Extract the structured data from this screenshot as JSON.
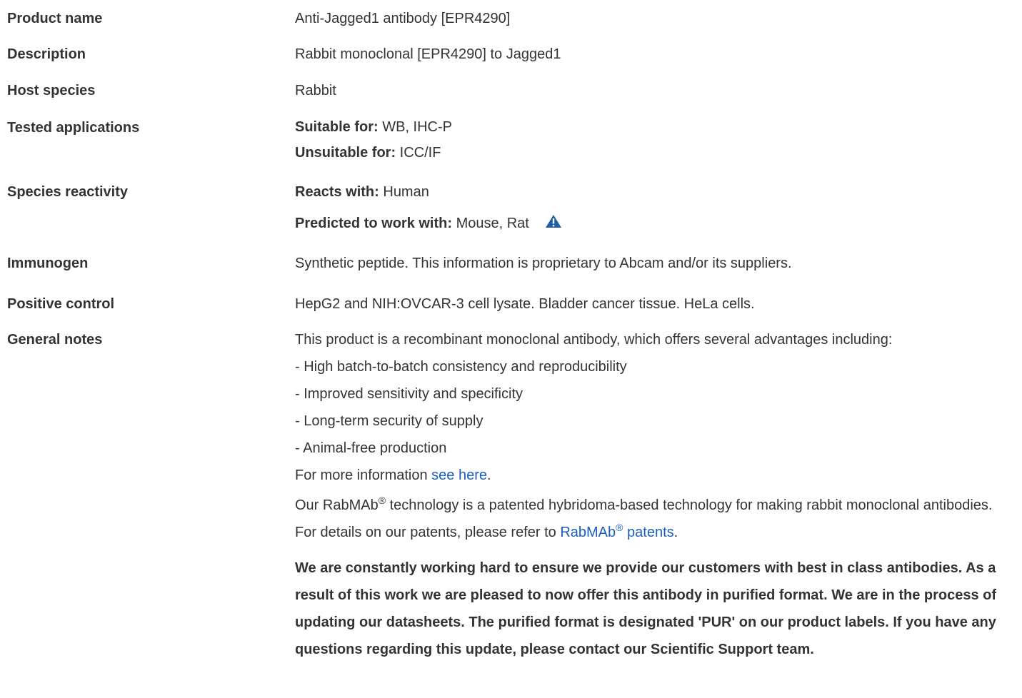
{
  "rows": {
    "product_name": {
      "label": "Product name",
      "value": "Anti-Jagged1 antibody [EPR4290]"
    },
    "description": {
      "label": "Description",
      "value": "Rabbit monoclonal [EPR4290] to Jagged1"
    },
    "host_species": {
      "label": "Host species",
      "value": "Rabbit"
    },
    "tested_applications": {
      "label": "Tested applications",
      "suitable_label": "Suitable for:",
      "suitable_value": " WB, IHC-P",
      "unsuitable_label": "Unsuitable for:",
      "unsuitable_value": " ICC/IF"
    },
    "species_reactivity": {
      "label": "Species reactivity",
      "reacts_label": "Reacts with:",
      "reacts_value": " Human",
      "predicted_label": "Predicted to work with:",
      "predicted_value": " Mouse, Rat",
      "icon": "warning-triangle-icon"
    },
    "immunogen": {
      "label": "Immunogen",
      "value": "Synthetic peptide. This information is proprietary to Abcam and/or its suppliers."
    },
    "positive_control": {
      "label": "Positive control",
      "value": "HepG2 and NIH:OVCAR-3 cell lysate. Bladder cancer tissue. HeLa cells."
    },
    "general_notes": {
      "label": "General notes",
      "intro": "This product is a recombinant monoclonal antibody, which offers several advantages including:",
      "bullets": [
        "- High batch-to-batch consistency and reproducibility",
        "- Improved sensitivity and specificity",
        "- Long-term security of supply",
        "- Animal-free production"
      ],
      "more_info_prefix": "For more information ",
      "more_info_link": "see here",
      "more_info_suffix": ".",
      "rabmab_part1": "Our RabMAb",
      "rabmab_reg": "®",
      "rabmab_part2": " technology is a patented hybridoma-based technology for making rabbit monoclonal antibodies. For details on our patents, please refer to ",
      "patents_link_part1": "RabMAb",
      "patents_link_reg": "®",
      "patents_link_part2": " patents",
      "rabmab_end": ".",
      "bold_notice": "We are constantly working hard to ensure we provide our customers with best in class antibodies. As a result of this work we are pleased to now offer this antibody in purified format. We are in the process of updating our datasheets. The purified format is designated 'PUR' on our product labels. If you have any questions regarding this update, please contact our Scientific Support team."
    }
  },
  "colors": {
    "text": "#333333",
    "link": "#1a5ec2",
    "icon": "#1f5fa8"
  }
}
